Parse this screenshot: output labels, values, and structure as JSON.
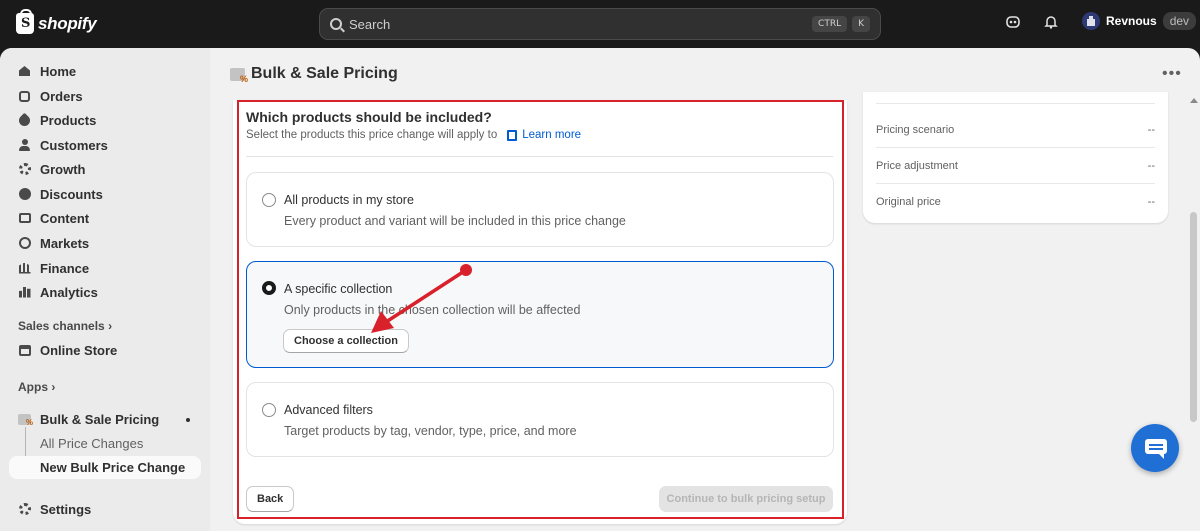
{
  "topbar": {
    "brand": "shopify",
    "search_placeholder": "Search",
    "shortcut_keys": [
      "CTRL",
      "K"
    ],
    "user_name": "Revnous",
    "store_badge": "dev"
  },
  "sidebar": {
    "items": [
      {
        "label": "Home",
        "icon": "home-icon"
      },
      {
        "label": "Orders",
        "icon": "orders-icon"
      },
      {
        "label": "Products",
        "icon": "tag-icon"
      },
      {
        "label": "Customers",
        "icon": "person-icon"
      },
      {
        "label": "Growth",
        "icon": "gear-icon"
      },
      {
        "label": "Discounts",
        "icon": "discount-icon"
      },
      {
        "label": "Content",
        "icon": "content-icon"
      },
      {
        "label": "Markets",
        "icon": "globe-icon"
      },
      {
        "label": "Finance",
        "icon": "bank-icon"
      },
      {
        "label": "Analytics",
        "icon": "chart-icon"
      }
    ],
    "sales_channels_label": "Sales channels",
    "online_store_label": "Online Store",
    "apps_label": "Apps",
    "app_name": "Bulk & Sale Pricing",
    "app_sub_items": [
      "All Price Changes",
      "New Bulk Price Change"
    ],
    "settings_label": "Settings"
  },
  "page": {
    "title": "Bulk & Sale Pricing",
    "question_title": "Which products should be included?",
    "question_subtitle": "Select the products this price change will apply to",
    "learn_more": "Learn more",
    "options": [
      {
        "label": "All products in my store",
        "description": "Every product and variant will be included in this price change",
        "selected": false
      },
      {
        "label": "A specific collection",
        "description": "Only products in the chosen collection will be affected",
        "selected": true
      },
      {
        "label": "Advanced filters",
        "description": "Target products by tag, vendor, type, price, and more",
        "selected": false
      }
    ],
    "choose_collection_button": "Choose a collection",
    "back_button": "Back",
    "continue_button": "Continue to bulk pricing setup"
  },
  "summary": {
    "rows": [
      {
        "label": "Pricing scenario",
        "value": "--"
      },
      {
        "label": "Price adjustment",
        "value": "--"
      },
      {
        "label": "Original price",
        "value": "--"
      }
    ]
  },
  "colors": {
    "accent_blue": "#005bd3",
    "annotation_red": "#d9212c",
    "topbar": "#1a1a1a"
  }
}
